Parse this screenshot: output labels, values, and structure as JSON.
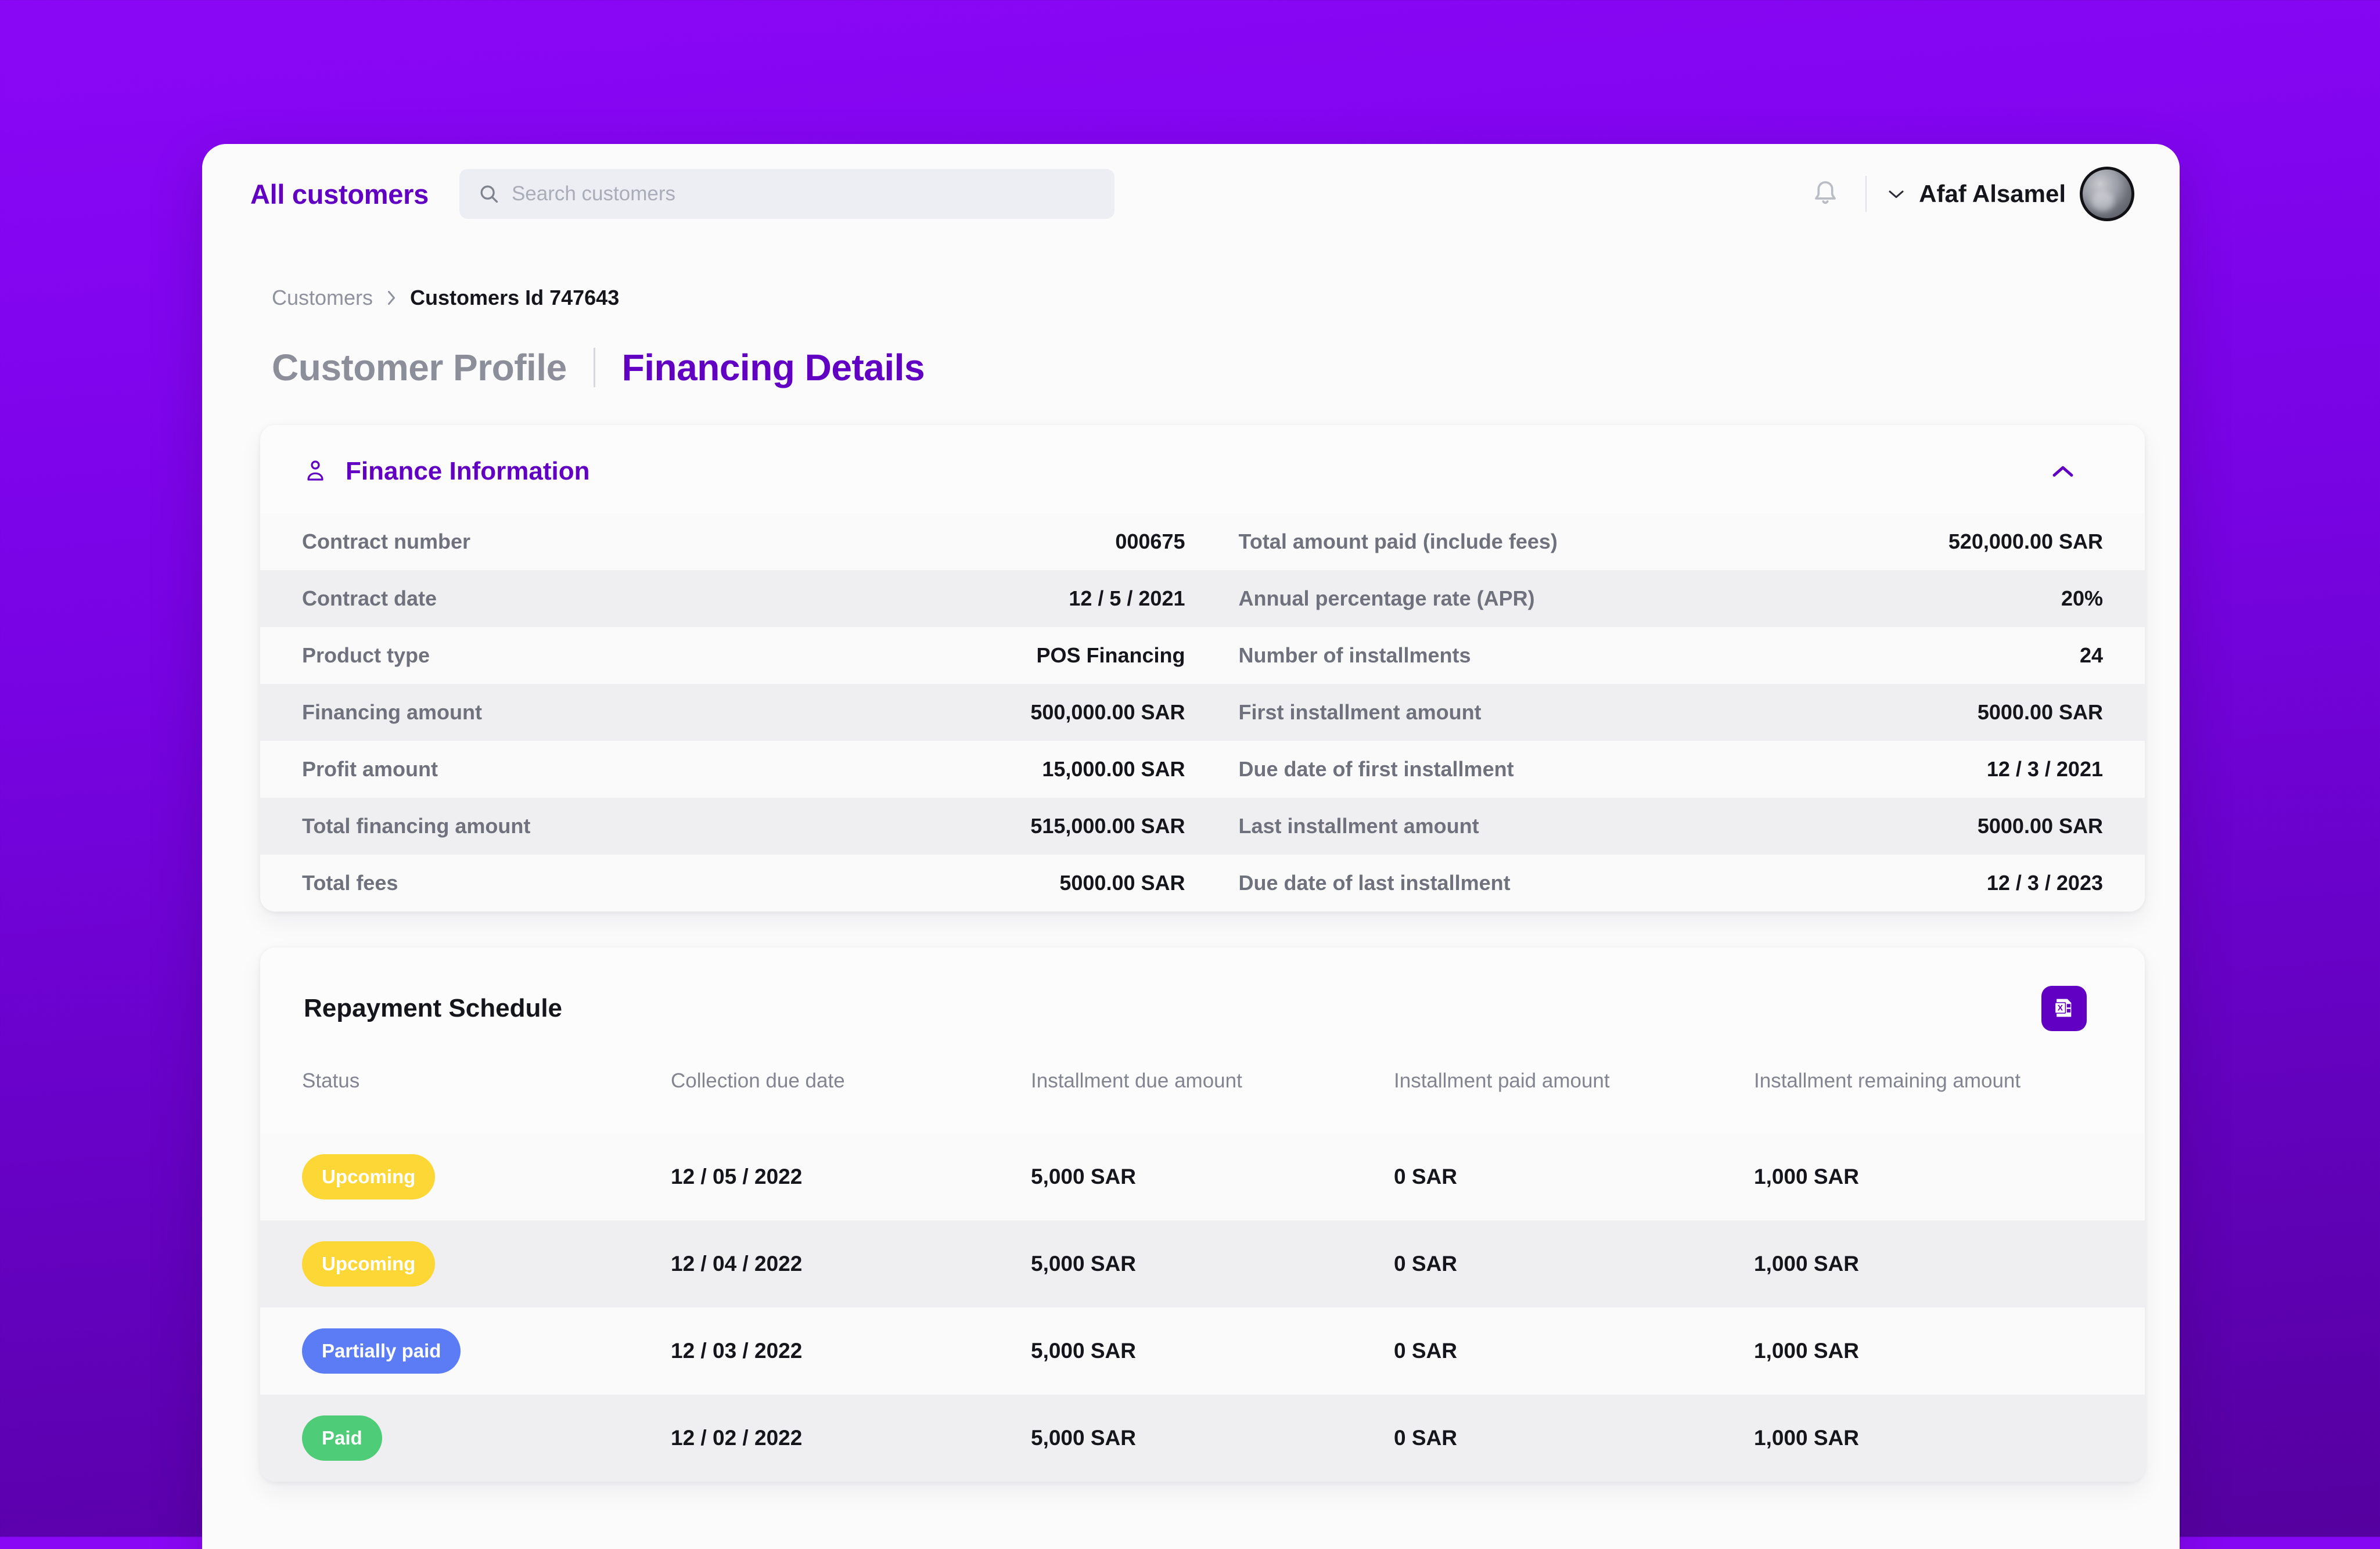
{
  "theme": {
    "brand_purple": "#6100C2",
    "bg_gradient_top": "#8A07F5",
    "bg_gradient_bottom": "#55009F",
    "badge_upcoming": "#FCD736",
    "badge_partial": "#5B7CF5",
    "badge_paid": "#4FCC77"
  },
  "topbar": {
    "brand": "All customers",
    "search_placeholder": "Search customers",
    "search_value": "",
    "user_name": "Afaf Alsamel"
  },
  "breadcrumb": {
    "root": "Customers",
    "separator": "›",
    "current": "Customers Id 747643"
  },
  "titles": {
    "inactive": "Customer Profile",
    "active": "Financing Details"
  },
  "finance_card": {
    "title": "Finance Information",
    "rows": [
      {
        "left_label": "Contract number",
        "left_value": "000675",
        "right_label": "Total amount paid (include fees)",
        "right_value": "520,000.00 SAR"
      },
      {
        "left_label": "Contract date",
        "left_value": "12 / 5 / 2021",
        "right_label": "Annual percentage rate (APR)",
        "right_value": "20%"
      },
      {
        "left_label": "Product type",
        "left_value": "POS Financing",
        "right_label": "Number of installments",
        "right_value": "24"
      },
      {
        "left_label": "Financing amount",
        "left_value": "500,000.00 SAR",
        "right_label": "First installment amount",
        "right_value": "5000.00 SAR"
      },
      {
        "left_label": "Profit amount",
        "left_value": "15,000.00 SAR",
        "right_label": "Due date of first installment",
        "right_value": "12 / 3 / 2021"
      },
      {
        "left_label": "Total financing amount",
        "left_value": "515,000.00 SAR",
        "right_label": "Last installment amount",
        "right_value": "5000.00 SAR"
      },
      {
        "left_label": "Total fees",
        "left_value": "5000.00 SAR",
        "right_label": "Due date of last installment",
        "right_value": "12 / 3 / 2023"
      }
    ]
  },
  "repayment_card": {
    "title": "Repayment Schedule",
    "export_icon": "excel-export-icon",
    "columns": [
      "Status",
      "Collection due date",
      "Installment due amount",
      "Installment paid amount",
      "Installment remaining amount"
    ],
    "rows": [
      {
        "status": "Upcoming",
        "status_kind": "upcoming",
        "due_date": "12 / 05 / 2022",
        "due_amount": "5,000 SAR",
        "paid_amount": "0 SAR",
        "remaining_amount": "1,000 SAR"
      },
      {
        "status": "Upcoming",
        "status_kind": "upcoming",
        "due_date": "12 / 04 / 2022",
        "due_amount": "5,000 SAR",
        "paid_amount": "0 SAR",
        "remaining_amount": "1,000 SAR"
      },
      {
        "status": "Partially paid",
        "status_kind": "partial",
        "due_date": "12 / 03 / 2022",
        "due_amount": "5,000 SAR",
        "paid_amount": "0 SAR",
        "remaining_amount": "1,000 SAR"
      },
      {
        "status": "Paid",
        "status_kind": "paid",
        "due_date": "12 / 02 / 2022",
        "due_amount": "5,000 SAR",
        "paid_amount": "0 SAR",
        "remaining_amount": "1,000 SAR"
      }
    ]
  }
}
